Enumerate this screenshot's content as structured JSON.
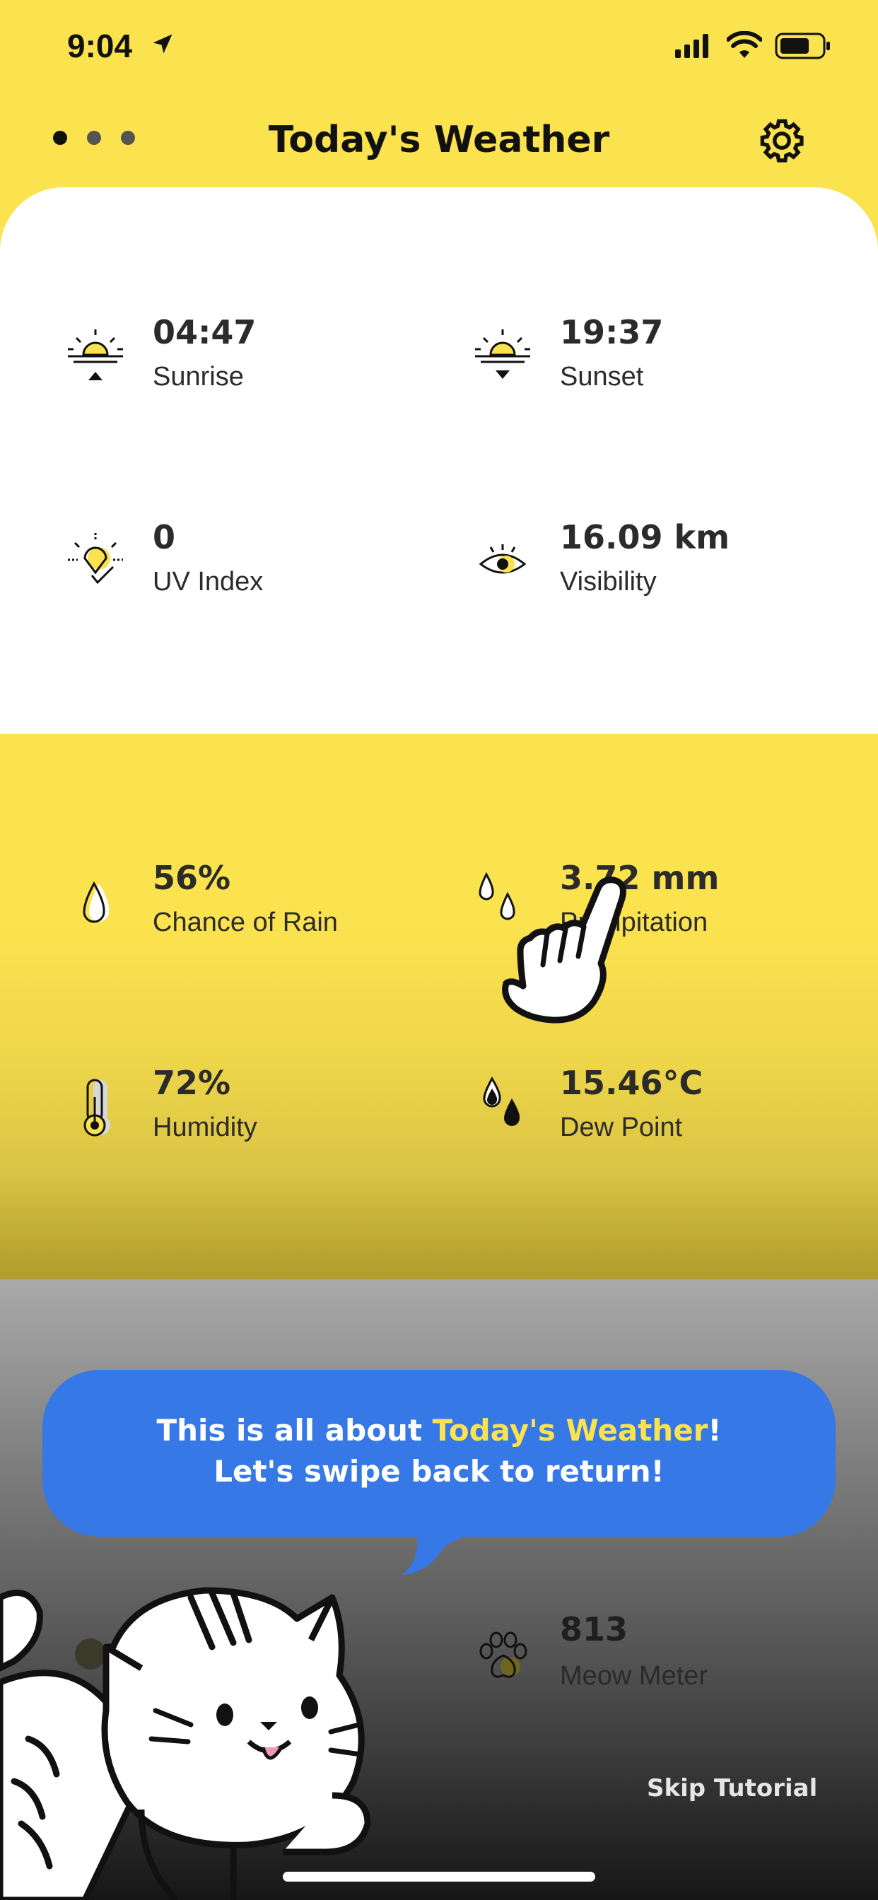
{
  "status_bar": {
    "time": "9:04"
  },
  "header": {
    "title": "Today's Weather",
    "settings_icon": "gear-icon",
    "page_dots": 3
  },
  "metrics": {
    "sunrise": {
      "value": "04:47",
      "label": "Sunrise",
      "icon": "sunrise-icon"
    },
    "sunset": {
      "value": "19:37",
      "label": "Sunset",
      "icon": "sunset-icon"
    },
    "uv": {
      "value": "0",
      "label": "UV Index",
      "icon": "uv-index-icon"
    },
    "visibility": {
      "value": "16.09 km",
      "label": "Visibility",
      "icon": "eye-icon"
    },
    "rain_chance": {
      "value": "56%",
      "label": "Chance of Rain",
      "icon": "raindrop-icon"
    },
    "precipitation": {
      "value": "3.72 mm",
      "label": "Precipitation",
      "icon": "raindrops-icon"
    },
    "humidity": {
      "value": "72%",
      "label": "Humidity",
      "icon": "thermometer-icon"
    },
    "dew_point": {
      "value": "15.46°C",
      "label": "Dew Point",
      "icon": "dew-point-icon"
    },
    "meow": {
      "value": "813",
      "label": "Meow Meter",
      "icon": "paw-icon"
    }
  },
  "tutorial": {
    "line1_prefix": "This is all about ",
    "line1_highlight": "Today's Weather",
    "line1_suffix": "!",
    "line2": "Let's swipe back to return!",
    "skip_label": "Skip Tutorial"
  },
  "colors": {
    "brand_yellow": "#fbe24f",
    "bubble_blue": "#3678e6"
  }
}
